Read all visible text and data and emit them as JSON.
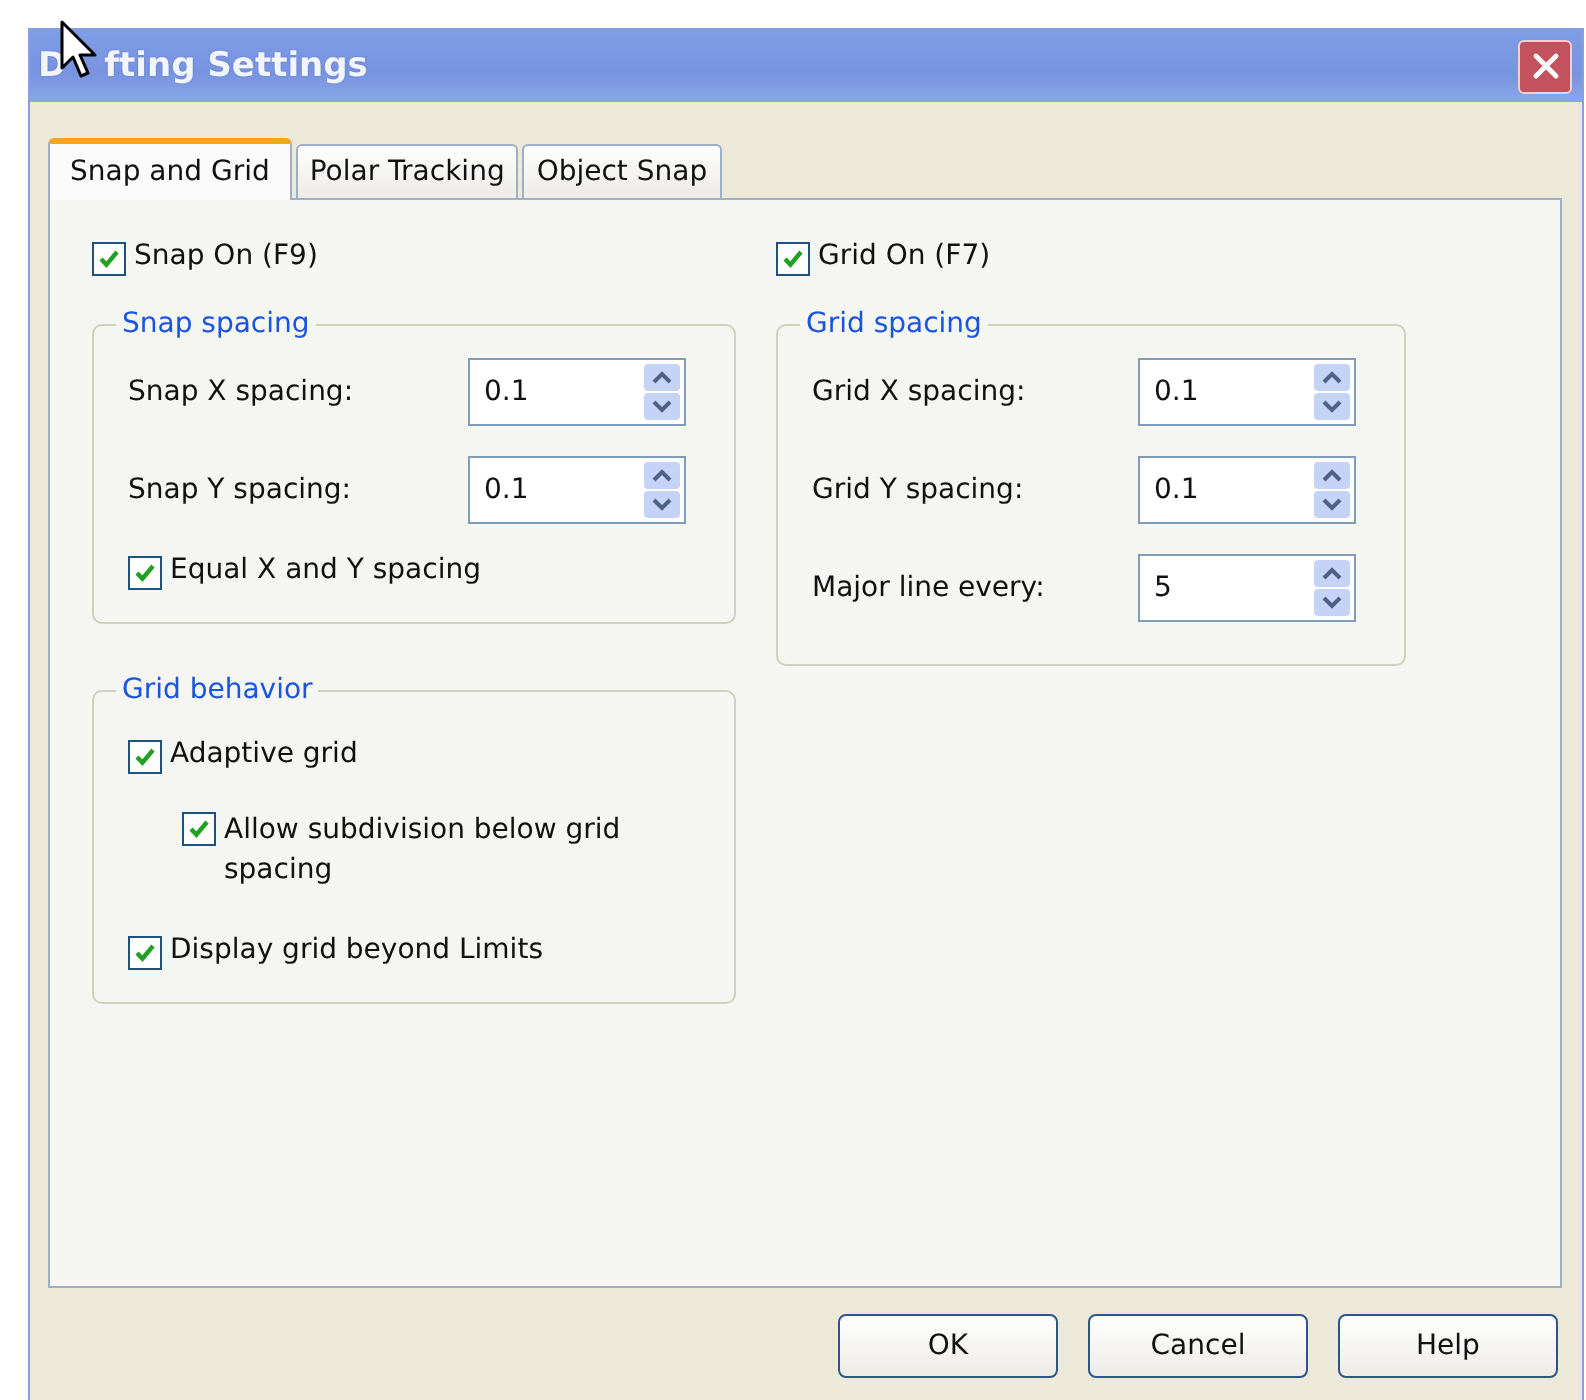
{
  "window": {
    "title_parts": [
      "D",
      "fting Settings"
    ]
  },
  "tabs": [
    {
      "label": "Snap and Grid",
      "selected": true
    },
    {
      "label": "Polar Tracking",
      "selected": false
    },
    {
      "label": "Object Snap",
      "selected": false
    }
  ],
  "columns": [
    {
      "toggle": {
        "label": "Snap On (F9)",
        "checked": true
      },
      "groups": [
        {
          "title": "Snap spacing",
          "items": [
            {
              "kind": "spinner",
              "label": "Snap X spacing:",
              "value": "0.1"
            },
            {
              "kind": "spinner",
              "label": "Snap Y spacing:",
              "value": "0.1"
            },
            {
              "kind": "checkbox",
              "label": "Equal X and Y spacing",
              "checked": true
            }
          ]
        },
        {
          "title": "Grid behavior",
          "items": [
            {
              "kind": "checkbox",
              "label": "Adaptive grid",
              "checked": true,
              "children": [
                {
                  "kind": "checkbox",
                  "label": "Allow subdivision below grid spacing",
                  "checked": true
                }
              ]
            },
            {
              "kind": "checkbox",
              "label": "Display grid beyond Limits",
              "checked": true
            }
          ]
        }
      ]
    },
    {
      "toggle": {
        "label": "Grid On (F7)",
        "checked": true
      },
      "groups": [
        {
          "title": "Grid spacing",
          "items": [
            {
              "kind": "spinner",
              "label": "Grid X spacing:",
              "value": "0.1"
            },
            {
              "kind": "spinner",
              "label": "Grid Y spacing:",
              "value": "0.1"
            },
            {
              "kind": "spinner",
              "label": "Major line every:",
              "value": "5"
            }
          ]
        }
      ]
    }
  ],
  "buttons": [
    "OK",
    "Cancel",
    "Help"
  ]
}
